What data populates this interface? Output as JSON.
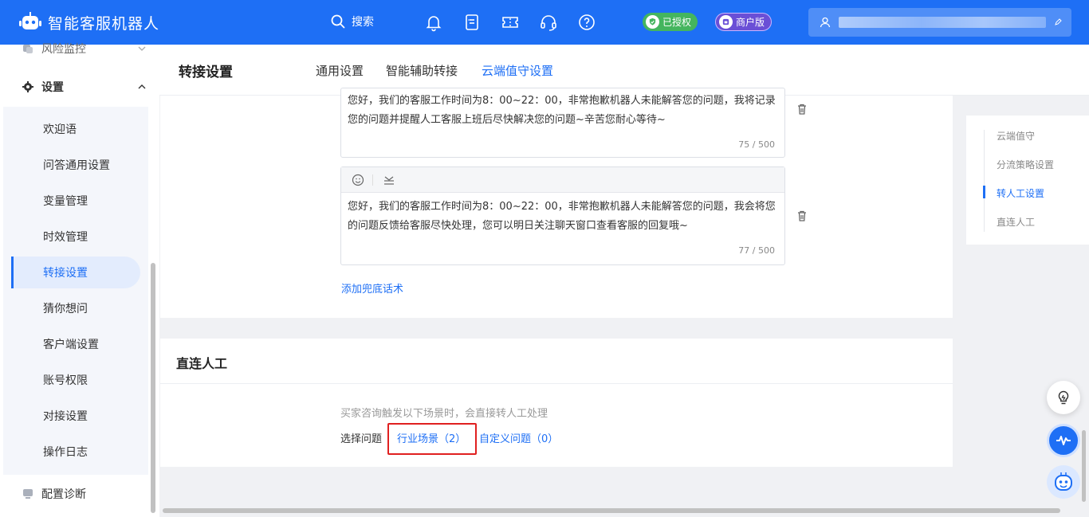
{
  "header": {
    "app_title": "智能客服机器人",
    "search_label": "搜索",
    "authorized_badge": "已授权",
    "merchant_badge": "商户版",
    "icons": [
      "bell-icon",
      "checklist-icon",
      "ticket-icon",
      "headset-icon",
      "help-icon"
    ]
  },
  "sidebar": {
    "risk_label": "风险监控",
    "settings_label": "设置",
    "items": [
      {
        "label": "欢迎语"
      },
      {
        "label": "问答通用设置"
      },
      {
        "label": "变量管理"
      },
      {
        "label": "时效管理"
      },
      {
        "label": "转接设置",
        "active": true
      },
      {
        "label": "猜你想问"
      },
      {
        "label": "客户端设置"
      },
      {
        "label": "账号权限"
      },
      {
        "label": "对接设置"
      },
      {
        "label": "操作日志"
      }
    ],
    "diagnosis_label": "配置诊断"
  },
  "page": {
    "title": "转接设置",
    "tabs": [
      {
        "label": "通用设置"
      },
      {
        "label": "智能辅助转接"
      },
      {
        "label": "云端值守设置",
        "active": true
      }
    ]
  },
  "fallback": {
    "messages": [
      {
        "text": "您好，我们的客服工作时间为8：00~22：00，非常抱歉机器人未能解答您的问题，我将记录您的问题并提醒人工客服上班后尽快解决您的问题~辛苦您耐心等待~",
        "count": "75 / 500"
      },
      {
        "text": "您好，我们的客服工作时间为8：00~22：00，非常抱歉机器人未能解答您的问题，我会将您的问题反馈给客服尽快处理，您可以明日关注聊天窗口查看客服的回复哦~",
        "count": "77 / 500"
      }
    ],
    "add_link": "添加兜底话术"
  },
  "direct": {
    "title": "直连人工",
    "hint": "买家咨询触发以下场景时，会直接转人工处理",
    "choose_label": "选择问题",
    "industry_link": "行业场景（2）",
    "custom_link": "自定义问题（0）"
  },
  "anchor": {
    "items": [
      {
        "label": "云端值守"
      },
      {
        "label": "分流策略设置"
      },
      {
        "label": "转人工设置",
        "active": true
      },
      {
        "label": "直连人工"
      }
    ]
  },
  "colors": {
    "primary": "#1e6ff5",
    "auth_green": "#44b55e",
    "merchant_purple": "#6a4fd6",
    "highlight_red": "#e02020"
  }
}
